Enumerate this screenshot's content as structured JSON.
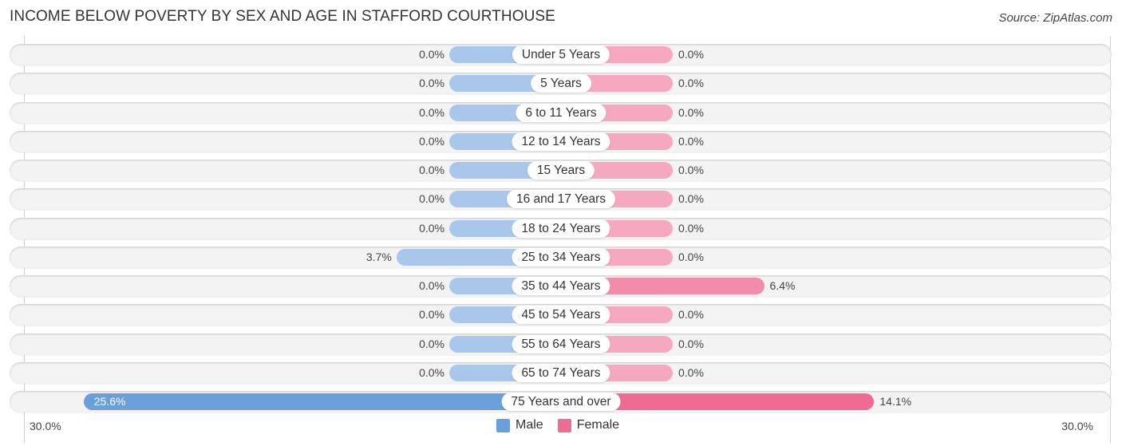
{
  "header": {
    "title": "INCOME BELOW POVERTY BY SEX AND AGE IN STAFFORD COURTHOUSE",
    "source": "Source: ZipAtlas.com"
  },
  "colors": {
    "male_light": "#a9c7ea",
    "male_strong": "#6a9fdb",
    "female_light": "#f6a8c0",
    "female_mid": "#f58bab",
    "female_strong": "#f06b94",
    "row_bg": "#f3f3f3"
  },
  "chart_data": {
    "type": "bar",
    "orientation": "horizontal-diverging",
    "title": "INCOME BELOW POVERTY BY SEX AND AGE IN STAFFORD COURTHOUSE",
    "categories": [
      "Under 5 Years",
      "5 Years",
      "6 to 11 Years",
      "12 to 14 Years",
      "15 Years",
      "16 and 17 Years",
      "18 to 24 Years",
      "25 to 34 Years",
      "35 to 44 Years",
      "45 to 54 Years",
      "55 to 64 Years",
      "65 to 74 Years",
      "75 Years and over"
    ],
    "series": [
      {
        "name": "Male",
        "values": [
          0.0,
          0.0,
          0.0,
          0.0,
          0.0,
          0.0,
          0.0,
          3.7,
          0.0,
          0.0,
          0.0,
          0.0,
          25.6
        ]
      },
      {
        "name": "Female",
        "values": [
          0.0,
          0.0,
          0.0,
          0.0,
          0.0,
          0.0,
          0.0,
          0.0,
          6.4,
          0.0,
          0.0,
          0.0,
          14.1
        ]
      }
    ],
    "value_labels": {
      "male": [
        "0.0%",
        "0.0%",
        "0.0%",
        "0.0%",
        "0.0%",
        "0.0%",
        "0.0%",
        "3.7%",
        "0.0%",
        "0.0%",
        "0.0%",
        "0.0%",
        "25.6%"
      ],
      "female": [
        "0.0%",
        "0.0%",
        "0.0%",
        "0.0%",
        "0.0%",
        "0.0%",
        "0.0%",
        "0.0%",
        "6.4%",
        "0.0%",
        "0.0%",
        "0.0%",
        "14.1%"
      ]
    },
    "xlim": [
      -30,
      30
    ],
    "axis_labels": {
      "left": "30.0%",
      "right": "30.0%"
    },
    "unit": "%",
    "legend": {
      "position": "bottom-center",
      "entries": [
        "Male",
        "Female"
      ]
    },
    "grid": false
  }
}
